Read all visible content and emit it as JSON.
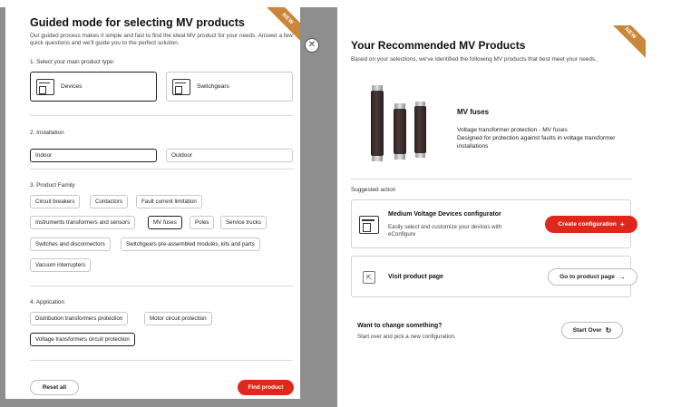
{
  "left": {
    "ribbon": "NEW",
    "title": "Guided mode for selecting MV products",
    "description": "Our guided process makes it simple and fast to find the ideal MV product for your needs. Answer a few quick questions and we'll guide you to the perfect solution.",
    "step1": {
      "label": "1. Select your main product type:",
      "options": [
        {
          "label": "Devices",
          "icon": "devices-icon",
          "selected": true
        },
        {
          "label": "Switchgears",
          "icon": "switchgears-icon",
          "selected": false
        }
      ]
    },
    "step2": {
      "label": "2. Installation",
      "options": [
        {
          "label": "Indoor",
          "selected": true
        },
        {
          "label": "Outdoor",
          "selected": false
        }
      ]
    },
    "step3": {
      "label": "3. Product Family",
      "chips": [
        {
          "label": "Circuit breakers",
          "selected": false
        },
        {
          "label": "Contactors",
          "selected": false
        },
        {
          "label": "Fault current limitation",
          "selected": false
        },
        {
          "label": "Instruments transformers and sensors",
          "selected": false
        },
        {
          "label": "MV fuses",
          "selected": true
        },
        {
          "label": "Poles",
          "selected": false
        },
        {
          "label": "Service trucks",
          "selected": false
        },
        {
          "label": "Switches and disconnectors",
          "selected": false
        },
        {
          "label": "Switchgears pre-assembled modules, kits and parts",
          "selected": false
        },
        {
          "label": "Vacuum interrupters",
          "selected": false
        }
      ]
    },
    "step4": {
      "label": "4. Application",
      "chips": [
        {
          "label": "Distribution transformers protection",
          "selected": false
        },
        {
          "label": "Motor circuit protection",
          "selected": false
        },
        {
          "label": "Voltage transformers circuit protection",
          "selected": true
        }
      ]
    },
    "reset_label": "Reset all",
    "find_label": "Find product"
  },
  "close_icon": "close-icon",
  "right": {
    "ribbon": "NEW",
    "title": "Your Recommended MV Products",
    "description": "Based on your selections, we've identified the following MV products that best meet your needs.",
    "product": {
      "name": "MV fuses",
      "line1": "Voltage transformer protection - MV fuses",
      "line2": "Designed for protection against faults in voltage transformer installations"
    },
    "suggested_label": "Suggested action",
    "configurator": {
      "title": "Medium Voltage Devices configurator",
      "text": "Easily select and customize your devices with eConfigure",
      "button": "Create configuration",
      "button_icon": "+"
    },
    "visit": {
      "title": "Visit product page",
      "button": "Go to product page",
      "button_icon": "→"
    },
    "change": {
      "title": "Want to change something?",
      "text": "Start over and pick a new configuration.",
      "button": "Start Over",
      "button_icon": "↻"
    }
  },
  "colors": {
    "accent": "#e1261c",
    "ribbon": "#c8873a",
    "backdrop": "#8e8e8e"
  }
}
